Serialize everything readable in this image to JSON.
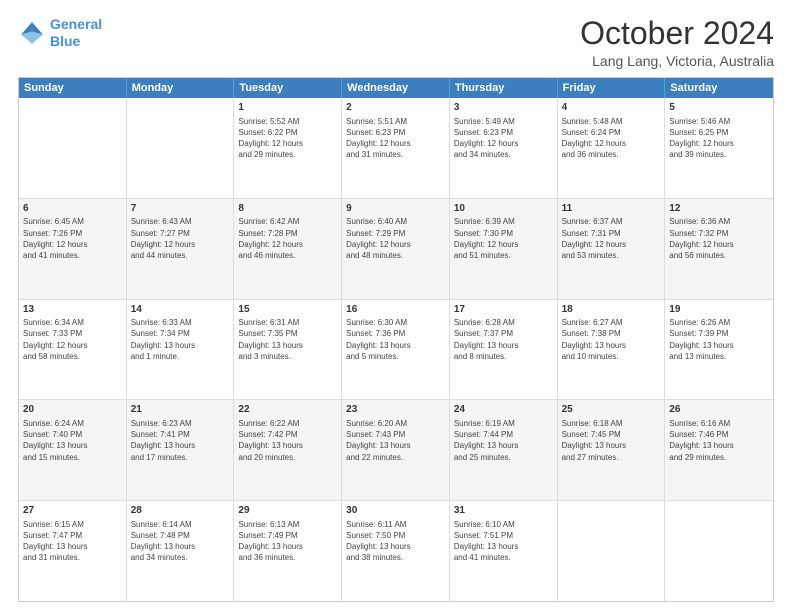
{
  "logo": {
    "line1": "General",
    "line2": "Blue"
  },
  "title": "October 2024",
  "subtitle": "Lang Lang, Victoria, Australia",
  "header_days": [
    "Sunday",
    "Monday",
    "Tuesday",
    "Wednesday",
    "Thursday",
    "Friday",
    "Saturday"
  ],
  "rows": [
    {
      "alt": false,
      "cells": [
        {
          "day": "",
          "info": ""
        },
        {
          "day": "",
          "info": ""
        },
        {
          "day": "1",
          "info": "Sunrise: 5:52 AM\nSunset: 6:22 PM\nDaylight: 12 hours\nand 29 minutes."
        },
        {
          "day": "2",
          "info": "Sunrise: 5:51 AM\nSunset: 6:23 PM\nDaylight: 12 hours\nand 31 minutes."
        },
        {
          "day": "3",
          "info": "Sunrise: 5:49 AM\nSunset: 6:23 PM\nDaylight: 12 hours\nand 34 minutes."
        },
        {
          "day": "4",
          "info": "Sunrise: 5:48 AM\nSunset: 6:24 PM\nDaylight: 12 hours\nand 36 minutes."
        },
        {
          "day": "5",
          "info": "Sunrise: 5:46 AM\nSunset: 6:25 PM\nDaylight: 12 hours\nand 39 minutes."
        }
      ]
    },
    {
      "alt": true,
      "cells": [
        {
          "day": "6",
          "info": "Sunrise: 6:45 AM\nSunset: 7:26 PM\nDaylight: 12 hours\nand 41 minutes."
        },
        {
          "day": "7",
          "info": "Sunrise: 6:43 AM\nSunset: 7:27 PM\nDaylight: 12 hours\nand 44 minutes."
        },
        {
          "day": "8",
          "info": "Sunrise: 6:42 AM\nSunset: 7:28 PM\nDaylight: 12 hours\nand 46 minutes."
        },
        {
          "day": "9",
          "info": "Sunrise: 6:40 AM\nSunset: 7:29 PM\nDaylight: 12 hours\nand 48 minutes."
        },
        {
          "day": "10",
          "info": "Sunrise: 6:39 AM\nSunset: 7:30 PM\nDaylight: 12 hours\nand 51 minutes."
        },
        {
          "day": "11",
          "info": "Sunrise: 6:37 AM\nSunset: 7:31 PM\nDaylight: 12 hours\nand 53 minutes."
        },
        {
          "day": "12",
          "info": "Sunrise: 6:36 AM\nSunset: 7:32 PM\nDaylight: 12 hours\nand 56 minutes."
        }
      ]
    },
    {
      "alt": false,
      "cells": [
        {
          "day": "13",
          "info": "Sunrise: 6:34 AM\nSunset: 7:33 PM\nDaylight: 12 hours\nand 58 minutes."
        },
        {
          "day": "14",
          "info": "Sunrise: 6:33 AM\nSunset: 7:34 PM\nDaylight: 13 hours\nand 1 minute."
        },
        {
          "day": "15",
          "info": "Sunrise: 6:31 AM\nSunset: 7:35 PM\nDaylight: 13 hours\nand 3 minutes."
        },
        {
          "day": "16",
          "info": "Sunrise: 6:30 AM\nSunset: 7:36 PM\nDaylight: 13 hours\nand 5 minutes."
        },
        {
          "day": "17",
          "info": "Sunrise: 6:28 AM\nSunset: 7:37 PM\nDaylight: 13 hours\nand 8 minutes."
        },
        {
          "day": "18",
          "info": "Sunrise: 6:27 AM\nSunset: 7:38 PM\nDaylight: 13 hours\nand 10 minutes."
        },
        {
          "day": "19",
          "info": "Sunrise: 6:26 AM\nSunset: 7:39 PM\nDaylight: 13 hours\nand 13 minutes."
        }
      ]
    },
    {
      "alt": true,
      "cells": [
        {
          "day": "20",
          "info": "Sunrise: 6:24 AM\nSunset: 7:40 PM\nDaylight: 13 hours\nand 15 minutes."
        },
        {
          "day": "21",
          "info": "Sunrise: 6:23 AM\nSunset: 7:41 PM\nDaylight: 13 hours\nand 17 minutes."
        },
        {
          "day": "22",
          "info": "Sunrise: 6:22 AM\nSunset: 7:42 PM\nDaylight: 13 hours\nand 20 minutes."
        },
        {
          "day": "23",
          "info": "Sunrise: 6:20 AM\nSunset: 7:43 PM\nDaylight: 13 hours\nand 22 minutes."
        },
        {
          "day": "24",
          "info": "Sunrise: 6:19 AM\nSunset: 7:44 PM\nDaylight: 13 hours\nand 25 minutes."
        },
        {
          "day": "25",
          "info": "Sunrise: 6:18 AM\nSunset: 7:45 PM\nDaylight: 13 hours\nand 27 minutes."
        },
        {
          "day": "26",
          "info": "Sunrise: 6:16 AM\nSunset: 7:46 PM\nDaylight: 13 hours\nand 29 minutes."
        }
      ]
    },
    {
      "alt": false,
      "cells": [
        {
          "day": "27",
          "info": "Sunrise: 6:15 AM\nSunset: 7:47 PM\nDaylight: 13 hours\nand 31 minutes."
        },
        {
          "day": "28",
          "info": "Sunrise: 6:14 AM\nSunset: 7:48 PM\nDaylight: 13 hours\nand 34 minutes."
        },
        {
          "day": "29",
          "info": "Sunrise: 6:13 AM\nSunset: 7:49 PM\nDaylight: 13 hours\nand 36 minutes."
        },
        {
          "day": "30",
          "info": "Sunrise: 6:11 AM\nSunset: 7:50 PM\nDaylight: 13 hours\nand 38 minutes."
        },
        {
          "day": "31",
          "info": "Sunrise: 6:10 AM\nSunset: 7:51 PM\nDaylight: 13 hours\nand 41 minutes."
        },
        {
          "day": "",
          "info": ""
        },
        {
          "day": "",
          "info": ""
        }
      ]
    }
  ]
}
